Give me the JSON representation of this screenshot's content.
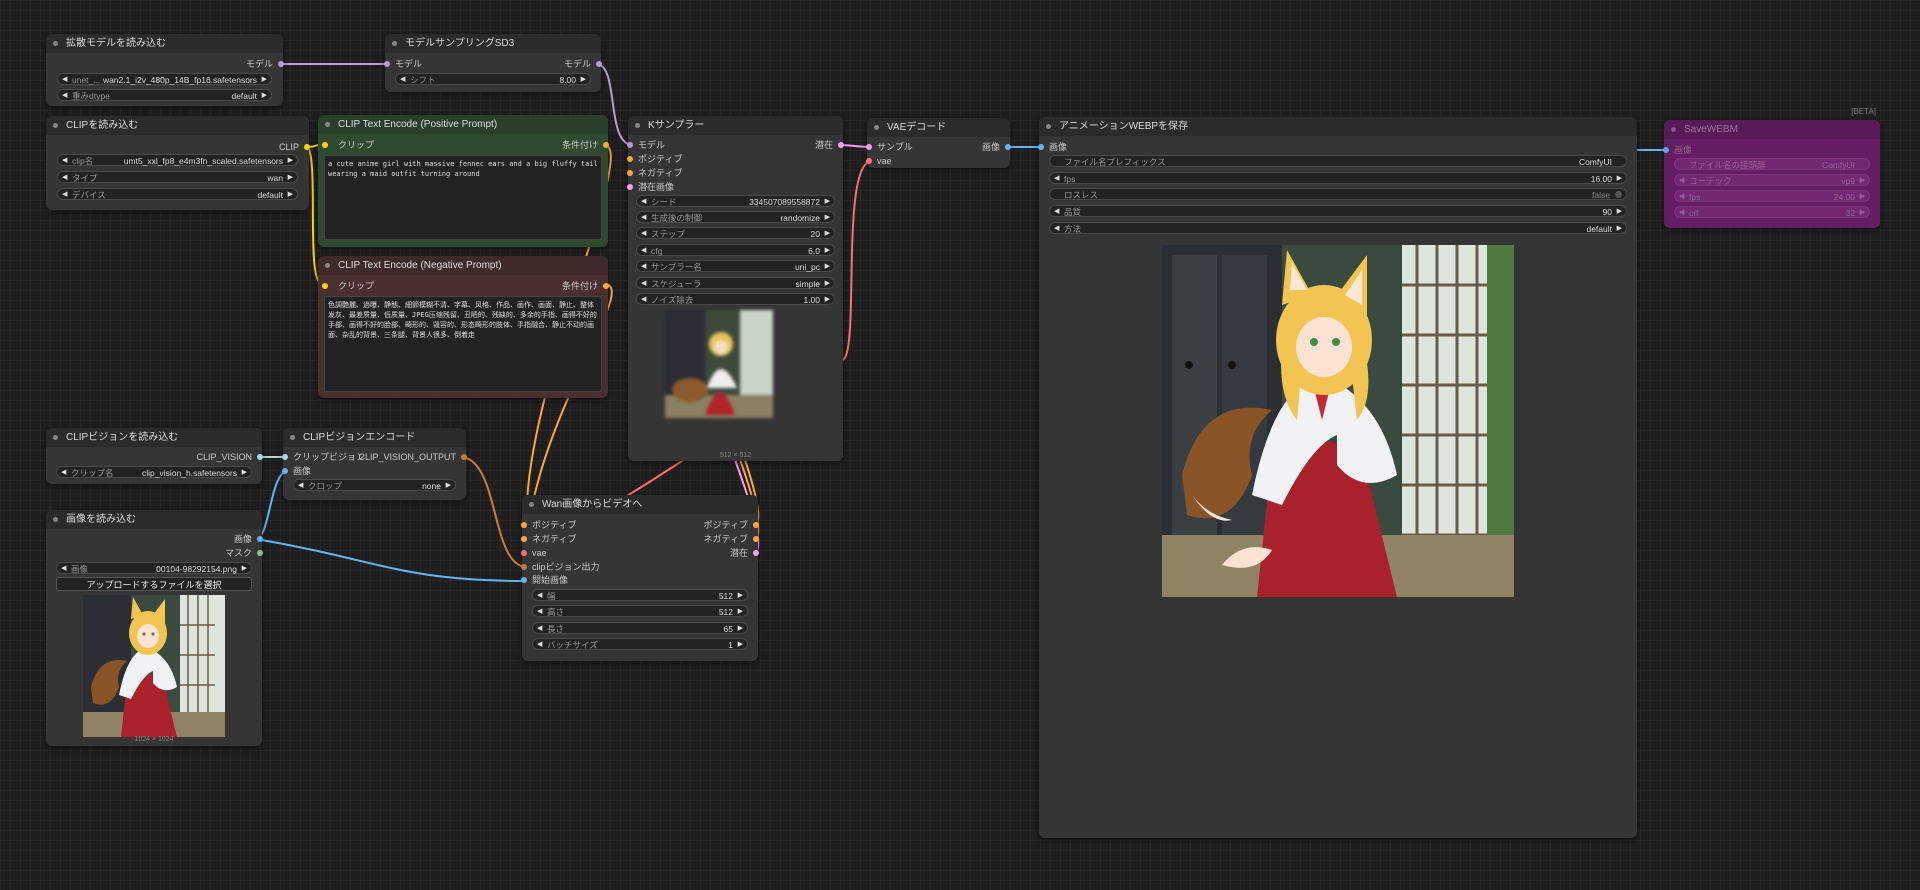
{
  "colors": {
    "model": "#b39ddb",
    "clip": "#ffd500",
    "conditioning": "#ffa931",
    "latent": "#ff9cf9",
    "vae": "#ff6e6e",
    "image": "#64b5f6",
    "clip_vision": "#a8dadc",
    "mask": "#81c784",
    "int": "#aaa"
  },
  "nodes": {
    "load_diffusion": {
      "title": "拡散モデルを読み込む",
      "out_model": "モデル",
      "w_unet_label": "unet_...",
      "w_unet_value": "wan2.1_i2v_480p_14B_fp16.safetensors",
      "w_dtype_label": "重みdtype",
      "w_dtype_value": "default"
    },
    "model_sampling": {
      "title": "モデルサンプリングSD3",
      "in_model": "モデル",
      "out_model": "モデル",
      "w_shift_label": "シフト",
      "w_shift_value": "8.00"
    },
    "load_clip": {
      "title": "CLIPを読み込む",
      "out_clip": "CLIP",
      "w_name_label": "clip名",
      "w_name_value": "umt5_xxl_fp8_e4m3fn_scaled.safetensors",
      "w_type_label": "タイプ",
      "w_type_value": "wan",
      "w_device_label": "デバイス",
      "w_device_value": "default"
    },
    "clip_pos": {
      "title": "CLIP Text Encode (Positive Prompt)",
      "in_clip": "クリップ",
      "out_cond": "条件付け",
      "text": "a cute anime girl with massive fennec ears and a big fluffy tail wearing a maid outfit turning around"
    },
    "clip_neg": {
      "title": "CLIP Text Encode (Negative Prompt)",
      "in_clip": "クリップ",
      "out_cond": "条件付け",
      "text": "色調艶麗、過曝、静態、細節模糊不清、字幕、风格、作品、画作、画面、静止、整体发灰、最差质量、低质量、JPEG压缩残留、丑陋的、残缺的、多余的手指、画得不好的手部、画得不好的脸部、畸形的、毁容的、形态畸形的肢体、手指融合、静止不动的画面、杂乱的背景、三条腿、背景人很多、倒着走"
    },
    "ksampler": {
      "title": "Kサンプラー",
      "in_model": "モデル",
      "in_pos": "ポジティブ",
      "in_neg": "ネガティブ",
      "in_latent": "潜在画像",
      "out_latent": "潜在",
      "w_seed_label": "シード",
      "w_seed_value": "334507089558872",
      "w_ctrl_label": "生成後の制御",
      "w_ctrl_value": "randomize",
      "w_steps_label": "ステップ",
      "w_steps_value": "20",
      "w_cfg_label": "cfg",
      "w_cfg_value": "6.0",
      "w_sampler_label": "サンプラー名",
      "w_sampler_value": "uni_pc",
      "w_sched_label": "スケジューラ",
      "w_sched_value": "simple",
      "w_denoise_label": "ノイズ除去",
      "w_denoise_value": "1.00",
      "preview_caption": "512 × 512"
    },
    "vae_decode": {
      "title": "VAEデコード",
      "in_samples": "サンプル",
      "in_vae": "vae",
      "out_image": "画像"
    },
    "save_webp": {
      "title": "アニメーションWEBPを保存",
      "in_images": "画像",
      "w_prefix_label": "ファイル名プレフィックス",
      "w_prefix_value": "ComfyUI",
      "w_fps_label": "fps",
      "w_fps_value": "16.00",
      "w_lossless_label": "ロスレス",
      "w_lossless_value": "false",
      "w_quality_label": "品質",
      "w_quality_value": "90",
      "w_method_label": "方法",
      "w_method_value": "default"
    },
    "save_webm": {
      "title": "SaveWEBM",
      "badge": "[BETA]",
      "in_images": "画像",
      "w_prefix_label": "ファイル名の接頭辞",
      "w_prefix_value": "ComfyUI",
      "w_codec_label": "コーデック",
      "w_codec_value": "vp9",
      "w_fps_label": "fps",
      "w_fps_value": "24.00",
      "w_crf_label": "crf",
      "w_crf_value": "32"
    },
    "load_clip_vision": {
      "title": "CLIPビジョンを読み込む",
      "out": "CLIP_VISION",
      "w_name_label": "クリップ名",
      "w_name_value": "clip_vision_h.safetensors"
    },
    "clip_vision_encode": {
      "title": "CLIPビジョンエンコード",
      "in_cv": "クリップビジョン",
      "in_image": "画像",
      "out": "CLIP_VISION_OUTPUT",
      "w_crop_label": "クロップ",
      "w_crop_value": "none"
    },
    "load_image": {
      "title": "画像を読み込む",
      "out_image": "画像",
      "out_mask": "マスク",
      "w_image_label": "画像",
      "w_image_value": "00104-98292154.png",
      "upload_label": "アップロードするファイルを選択",
      "preview_caption": "1024 × 1024"
    },
    "wan_i2v": {
      "title": "Wan画像からビデオへ",
      "in_pos": "ポジティブ",
      "in_neg": "ネガティブ",
      "in_vae": "vae",
      "in_cvo": "clipビジョン出力",
      "in_start": "開始画像",
      "out_pos": "ポジティブ",
      "out_neg": "ネガティブ",
      "out_latent": "潜在",
      "w_width_label": "幅",
      "w_width_value": "512",
      "w_height_label": "高さ",
      "w_height_value": "512",
      "w_length_label": "長さ",
      "w_length_value": "65",
      "w_batch_label": "バッチサイズ",
      "w_batch_value": "1"
    }
  }
}
